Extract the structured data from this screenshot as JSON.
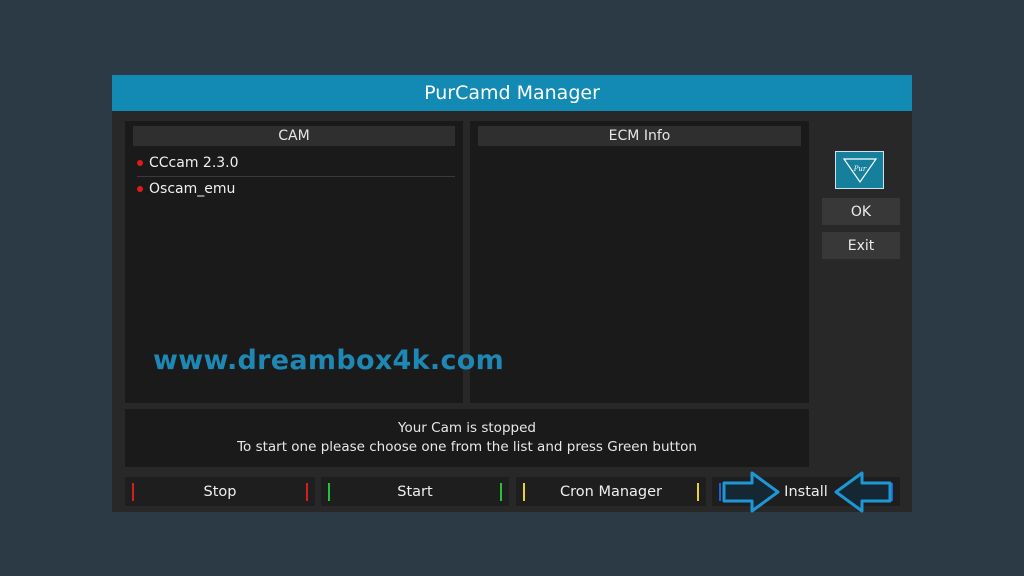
{
  "window": {
    "title": "PurCamd Manager"
  },
  "cam_panel": {
    "header": "CAM",
    "items": [
      {
        "label": "CCcam 2.3.0",
        "status_color": "#e21a1a"
      },
      {
        "label": "Oscam_emu",
        "status_color": "#e21a1a"
      }
    ]
  },
  "ecm_panel": {
    "header": "ECM Info"
  },
  "side": {
    "logo_icon": "purcamd-logo-icon",
    "ok_label": "OK",
    "exit_label": "Exit"
  },
  "status": {
    "line1": "Your Cam is stopped",
    "line2": "To start one please choose one from the list and press Green button"
  },
  "keys": {
    "red": {
      "label": "Stop",
      "color": "#d21f1f"
    },
    "green": {
      "label": "Start",
      "color": "#25c23a"
    },
    "yellow": {
      "label": "Cron Manager",
      "color": "#e8d23a"
    },
    "blue": {
      "label": "Install",
      "color": "#1e63c8"
    }
  },
  "watermark": "www.dreambox4k.com",
  "colors": {
    "accent": "#138ab4",
    "arrow": "#1f97d6"
  }
}
